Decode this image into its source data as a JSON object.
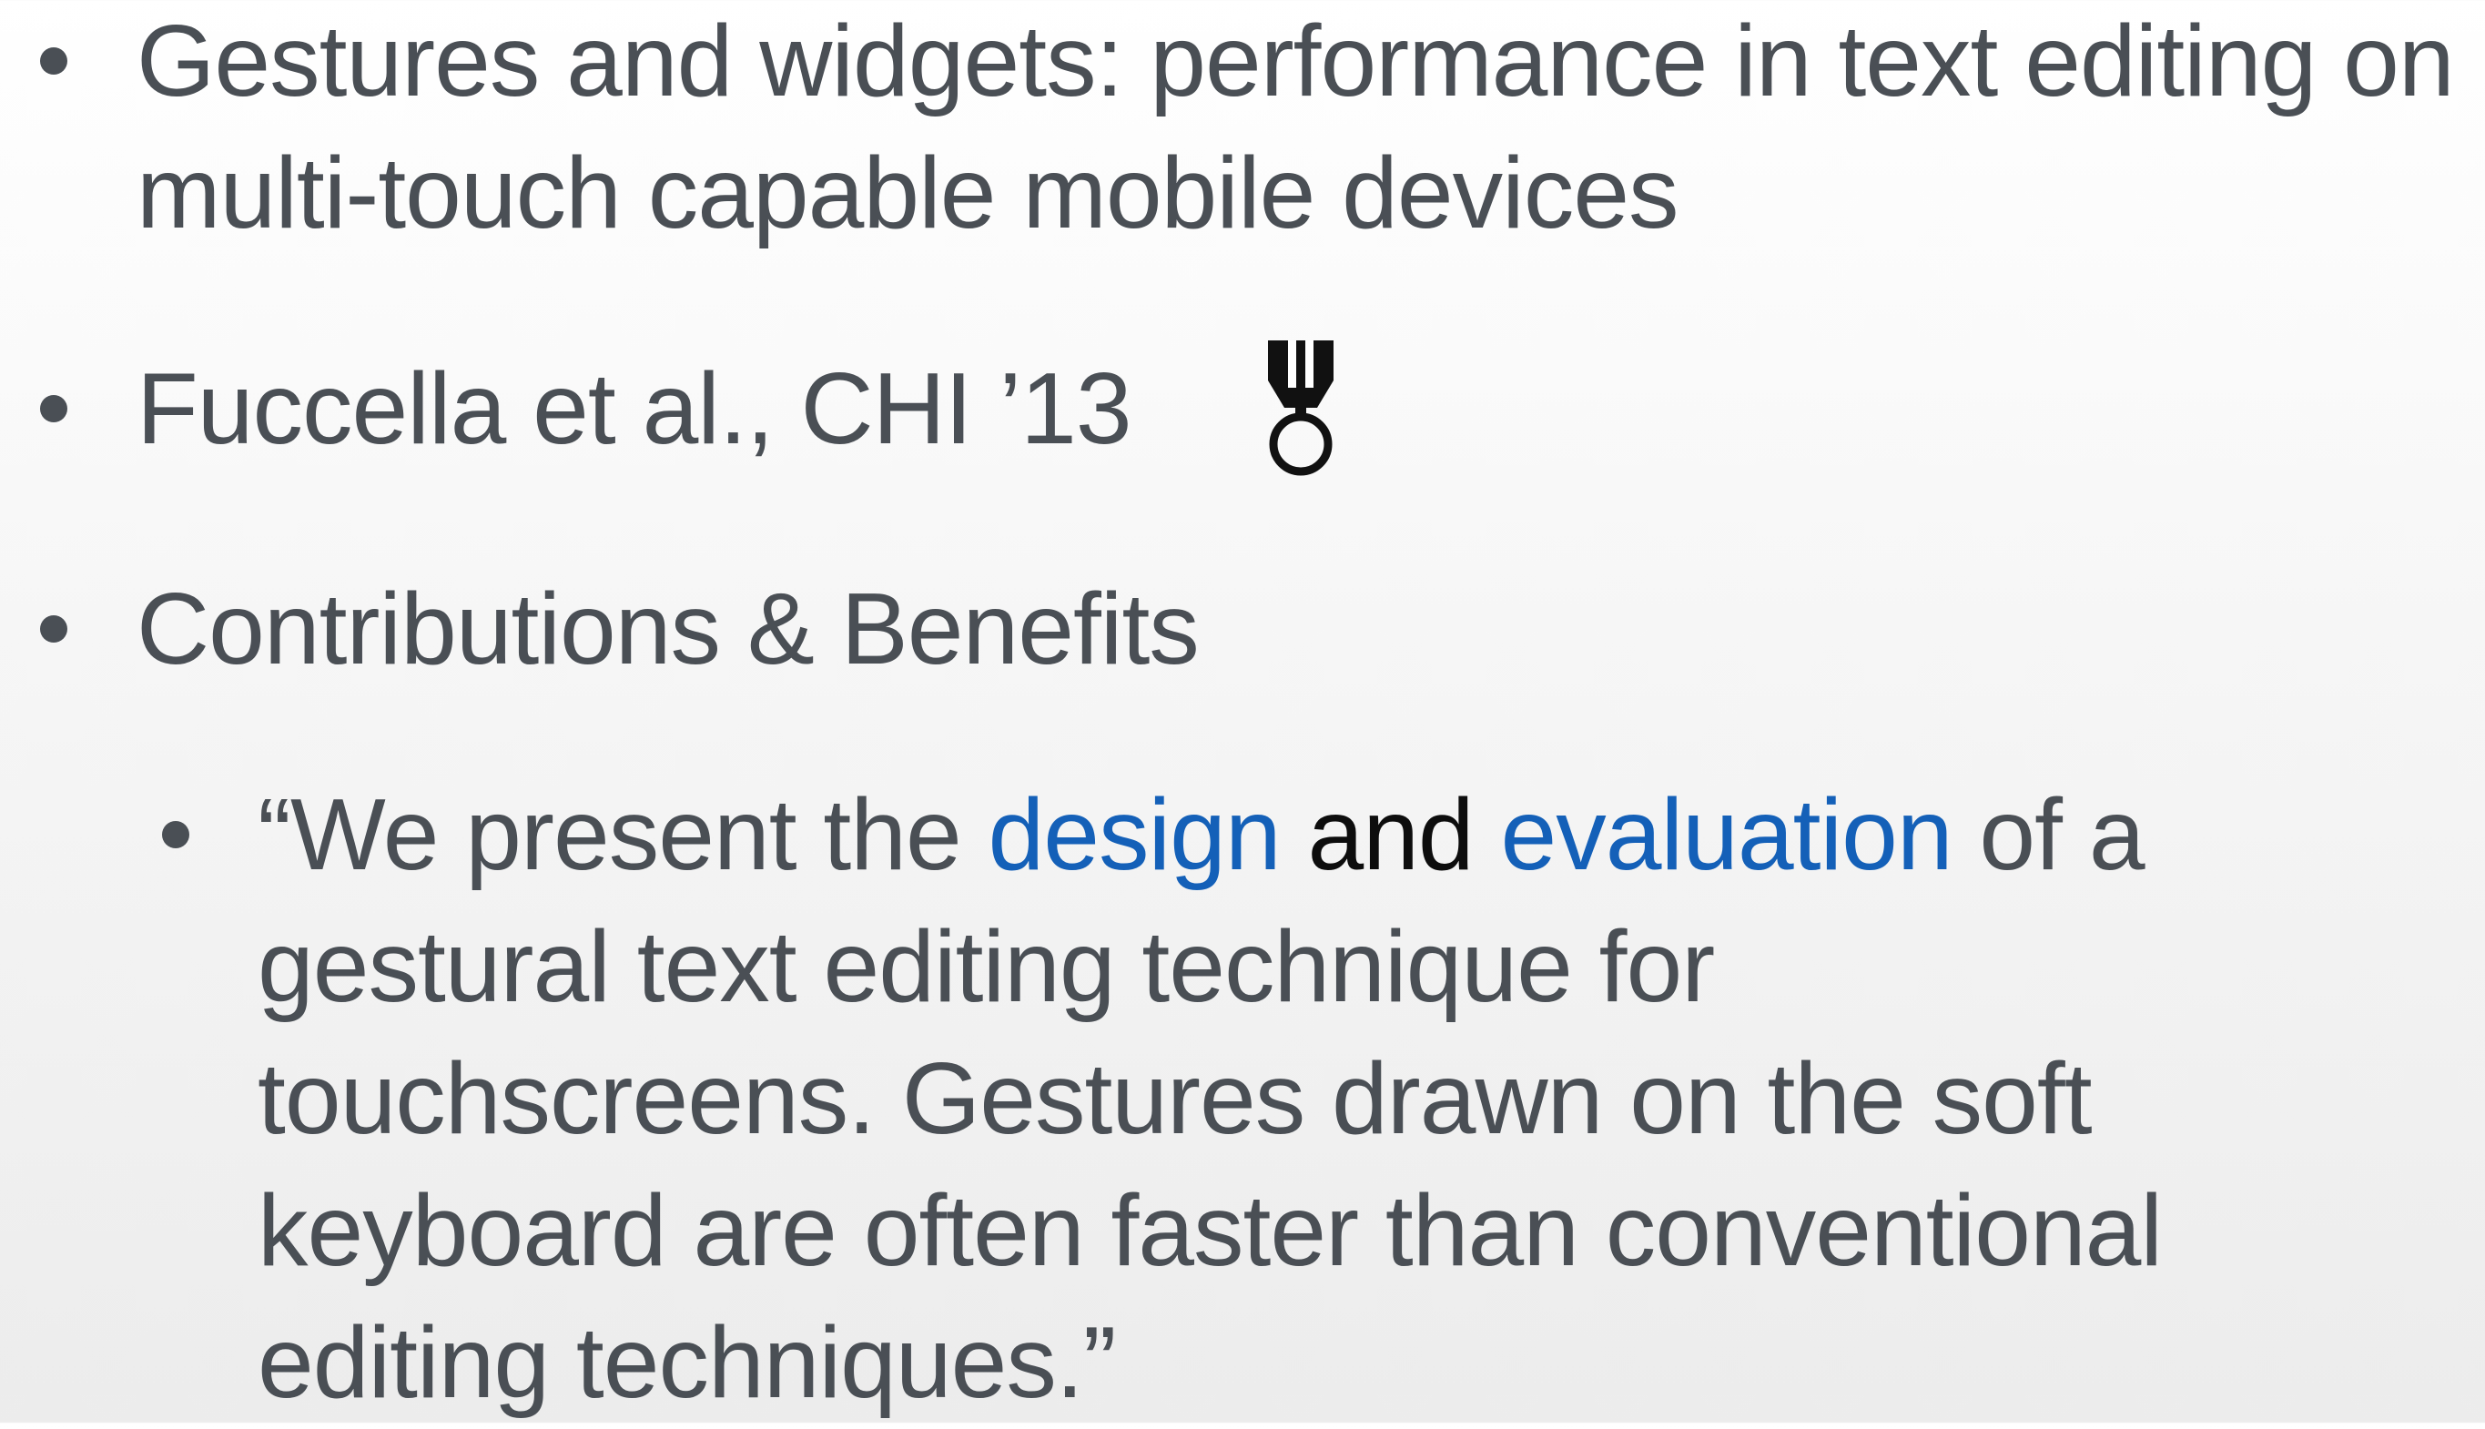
{
  "slide": {
    "bullets": [
      {
        "text": "Gestures and widgets: performance in text editing on multi-touch capable mobile devices"
      },
      {
        "text": "Fuccella et al., CHI ’13",
        "icon": "medal-icon"
      },
      {
        "text": "Contributions & Benefits"
      }
    ],
    "sub_bullet": {
      "part1": "“We present the ",
      "word_design": "design",
      "word_and": " and ",
      "word_evaluation": "evaluation",
      "part2": " of a gestural text editing technique for touchscreens. Gestures drawn on the soft keyboard are often faster than conventional editing techniques.”"
    },
    "colors": {
      "text": "#4a4f55",
      "highlight_blue": "#1460b8",
      "highlight_black": "#0d0d0d"
    }
  }
}
